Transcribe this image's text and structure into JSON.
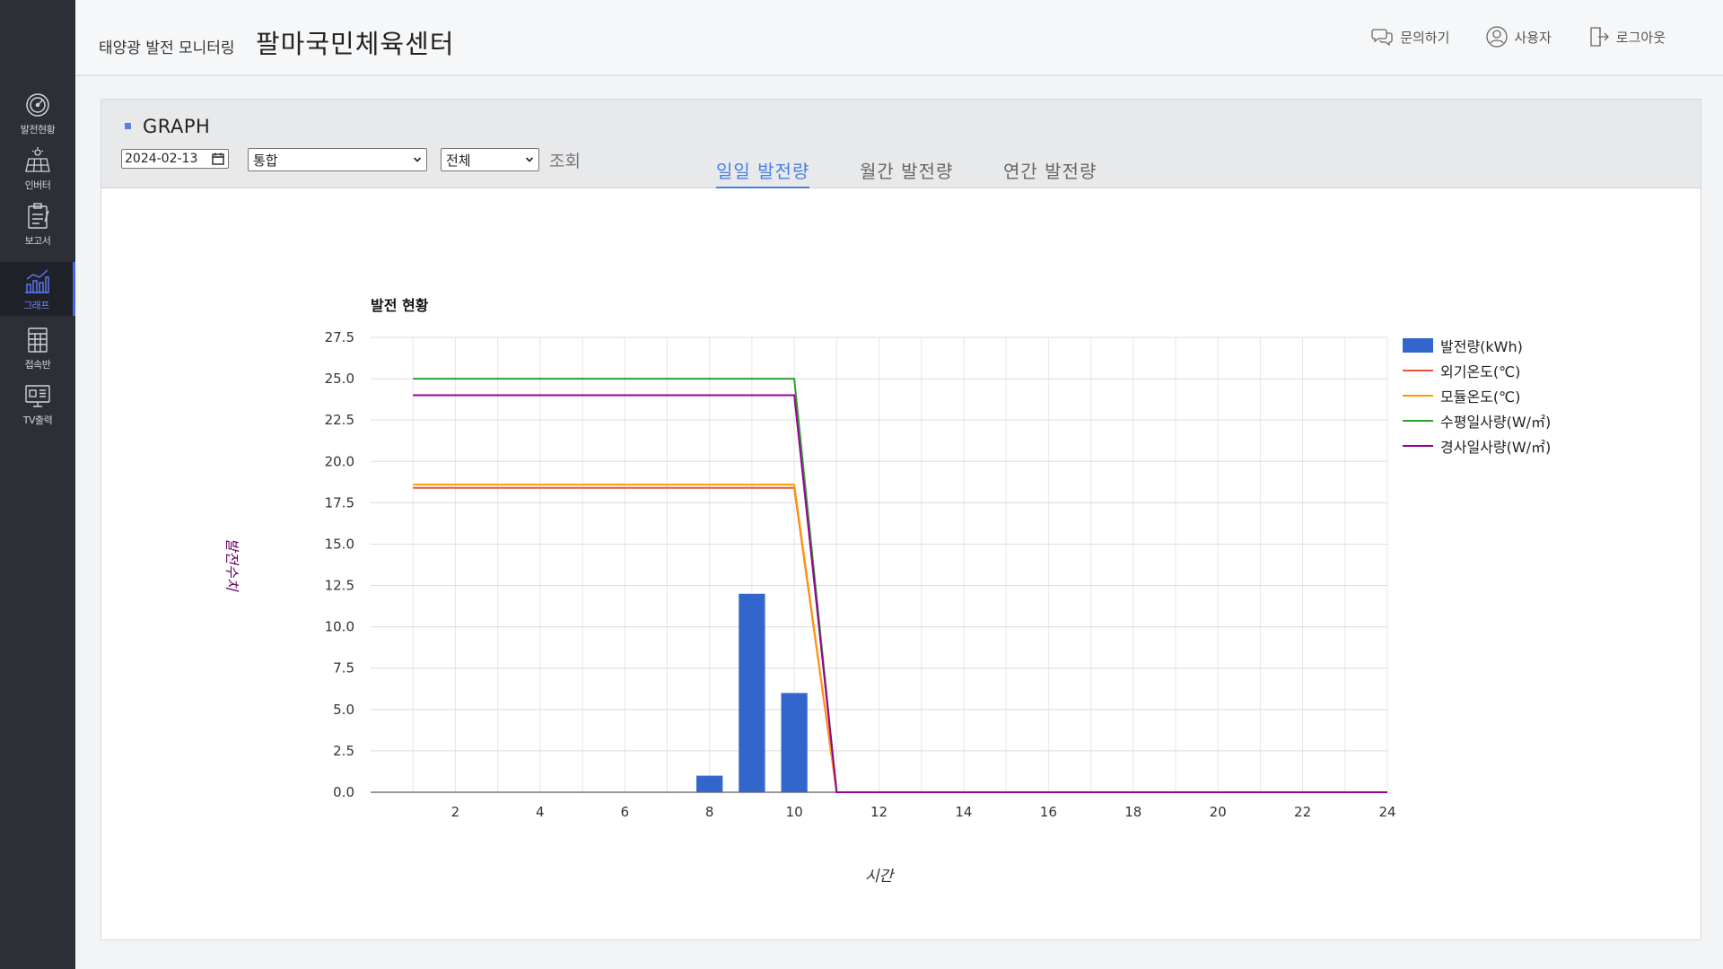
{
  "header": {
    "subtitle": "태양광 발전 모니터링",
    "site_name": "팔마국민체육센터",
    "actions": [
      {
        "label": "문의하기",
        "icon": "chat-icon"
      },
      {
        "label": "사용자",
        "icon": "user-icon"
      },
      {
        "label": "로그아웃",
        "icon": "logout-icon"
      }
    ]
  },
  "sidebar": {
    "items": [
      {
        "label": "발전현황",
        "icon": "gauge-icon",
        "active": false
      },
      {
        "label": "인버터",
        "icon": "solar-panel-icon",
        "active": false
      },
      {
        "label": "보고서",
        "icon": "clipboard-icon",
        "active": false
      },
      {
        "label": "그래프",
        "icon": "chart-icon",
        "active": true
      },
      {
        "label": "접속반",
        "icon": "junction-box-icon",
        "active": false
      },
      {
        "label": "TV출력",
        "icon": "tv-icon",
        "active": false
      }
    ],
    "active_color": "#4a63e7"
  },
  "panel": {
    "title": "GRAPH",
    "date_value": "2024-02-13",
    "select_type": "통합",
    "select_range": "전체",
    "query_label": "조회",
    "tabs": [
      {
        "label": "일일 발전량",
        "active": true
      },
      {
        "label": "월간 발전량",
        "active": false
      },
      {
        "label": "연간 발전량",
        "active": false
      }
    ]
  },
  "chart_data": {
    "type": "bar",
    "title": "발전 현황",
    "xlabel": "시간",
    "ylabel": "발전수치",
    "xlim": [
      0,
      24
    ],
    "ylim": [
      0,
      27.5
    ],
    "y_ticks": [
      0,
      2.5,
      5,
      7.5,
      10,
      12.5,
      15,
      17.5,
      20,
      22.5,
      25,
      27.5
    ],
    "x_ticks": [
      2,
      4,
      6,
      8,
      10,
      12,
      14,
      16,
      18,
      20,
      22,
      24
    ],
    "grid": true,
    "legend_position": "right",
    "x": [
      1,
      2,
      3,
      4,
      5,
      6,
      7,
      8,
      9,
      10,
      11,
      12,
      13,
      14,
      15,
      16,
      17,
      18,
      19,
      20,
      21,
      22,
      23,
      24
    ],
    "series": [
      {
        "name": "발전량(kWh)",
        "type": "bar",
        "color": "#3366cc",
        "values": [
          0,
          0,
          0,
          0,
          0,
          0,
          0,
          1,
          12,
          6,
          0,
          0,
          0,
          0,
          0,
          0,
          0,
          0,
          0,
          0,
          0,
          0,
          0,
          0
        ]
      },
      {
        "name": "외기온도(℃)",
        "type": "line",
        "color": "#e8553a",
        "values": [
          18.4,
          18.4,
          18.4,
          18.4,
          18.4,
          18.4,
          18.4,
          18.4,
          18.4,
          18.4,
          0,
          0,
          0,
          0,
          0,
          0,
          0,
          0,
          0,
          0,
          0,
          0,
          0,
          0
        ]
      },
      {
        "name": "모듈온도(℃)",
        "type": "line",
        "color": "#ff9900",
        "values": [
          18.6,
          18.6,
          18.6,
          18.6,
          18.6,
          18.6,
          18.6,
          18.6,
          18.6,
          18.6,
          0,
          0,
          0,
          0,
          0,
          0,
          0,
          0,
          0,
          0,
          0,
          0,
          0,
          0
        ]
      },
      {
        "name": "수평일사량(W/㎡)",
        "type": "line",
        "color": "#2ca02c",
        "values": [
          25,
          25,
          25,
          25,
          25,
          25,
          25,
          25,
          25,
          25,
          0,
          0,
          0,
          0,
          0,
          0,
          0,
          0,
          0,
          0,
          0,
          0,
          0,
          0
        ]
      },
      {
        "name": "경사일사량(W/㎡)",
        "type": "line",
        "color": "#990099",
        "values": [
          24,
          24,
          24,
          24,
          24,
          24,
          24,
          24,
          24,
          24,
          0,
          0,
          0,
          0,
          0,
          0,
          0,
          0,
          0,
          0,
          0,
          0,
          0,
          0
        ]
      }
    ]
  }
}
